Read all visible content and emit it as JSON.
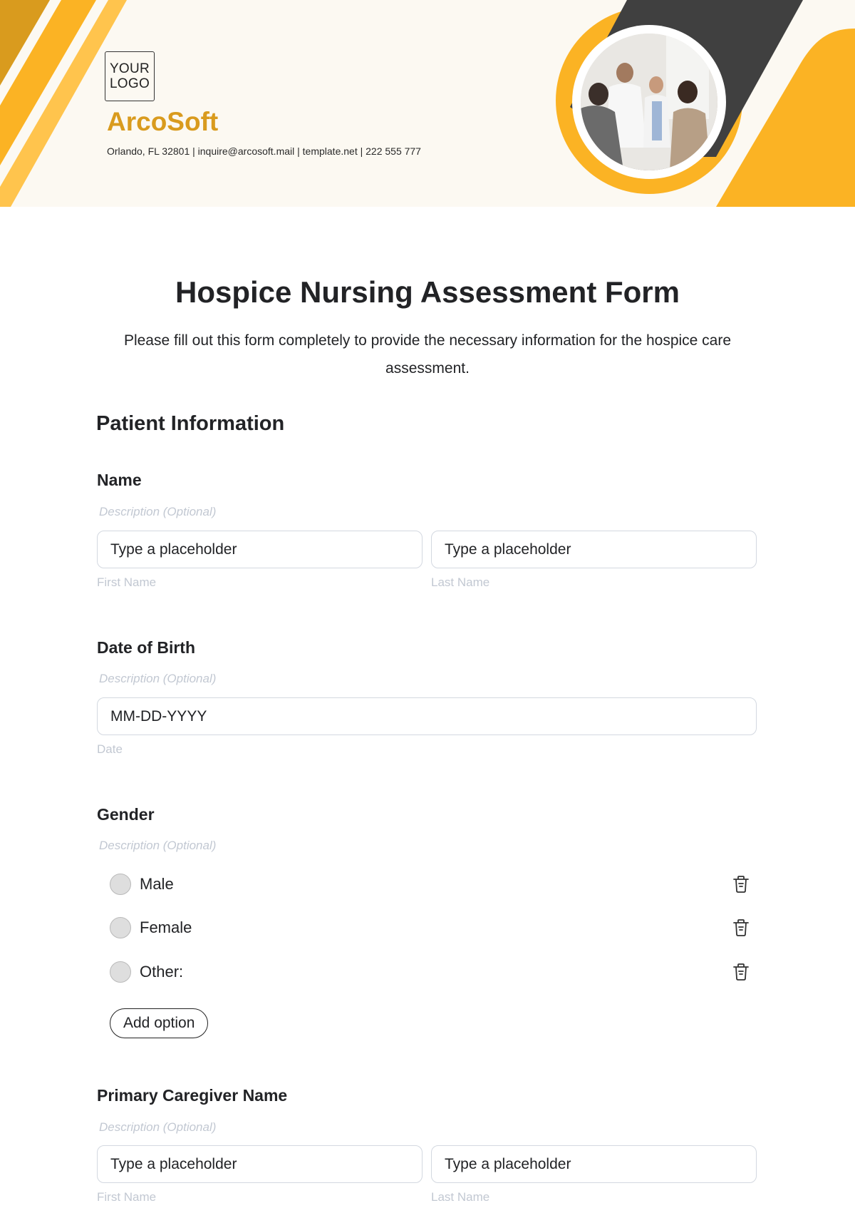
{
  "header": {
    "logo_line1": "YOUR",
    "logo_line2": "LOGO",
    "brand_name": "ArcoSoft",
    "contact": "Orlando, FL 32801 | inquire@arcosoft.mail | template.net | 222 555 777",
    "photo_alt": "Doctors greeting patients in a clinic"
  },
  "colors": {
    "accent": "#fbb324",
    "accent_dark": "#d99b1e",
    "accent_light": "#ffc44d",
    "charcoal": "#404040",
    "header_bg": "#fcf9f2"
  },
  "form": {
    "title": "Hospice Nursing Assessment Form",
    "intro": "Please fill out this form completely to provide the necessary information for the hospice care assessment.",
    "section_title": "Patient Information",
    "questions": {
      "name": {
        "label": "Name",
        "description": "Description (Optional)",
        "first_placeholder": "Type a placeholder",
        "last_placeholder": "Type a placeholder",
        "first_sub": "First Name",
        "last_sub": "Last Name"
      },
      "dob": {
        "label": "Date of Birth",
        "description": "Description (Optional)",
        "placeholder": "MM-DD-YYYY",
        "sub": "Date"
      },
      "gender": {
        "label": "Gender",
        "description": "Description (Optional)",
        "options": [
          "Male",
          "Female",
          "Other:"
        ],
        "add_option_label": "Add option",
        "delete_icon": "trash-icon"
      },
      "caregiver": {
        "label": "Primary Caregiver Name",
        "description": "Description (Optional)",
        "first_placeholder": "Type a placeholder",
        "last_placeholder": "Type a placeholder",
        "first_sub": "First Name",
        "last_sub": "Last Name"
      }
    }
  }
}
